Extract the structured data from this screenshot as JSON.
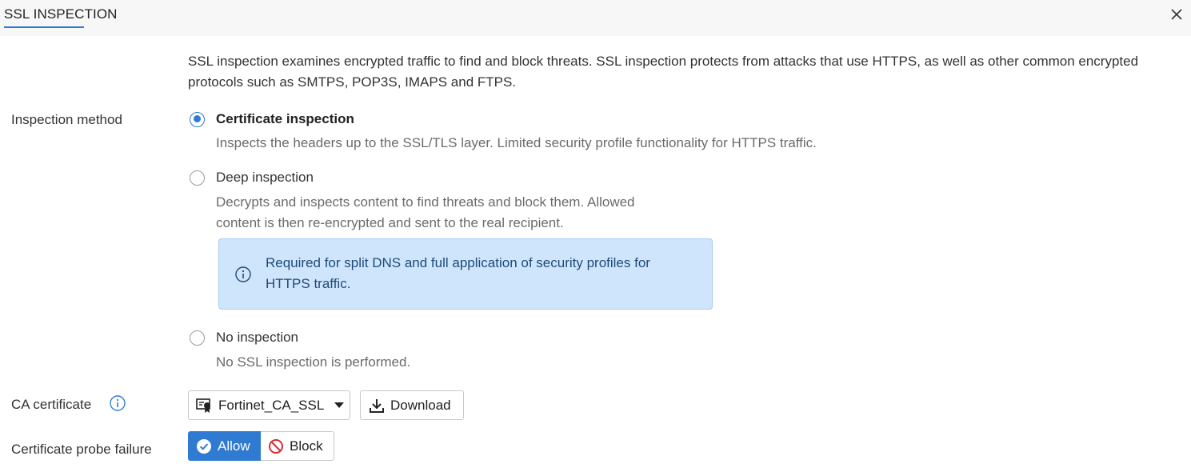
{
  "dialog": {
    "title": "SSL INSPECTION",
    "close_icon": "close-icon"
  },
  "intro": "SSL inspection examines encrypted traffic to find and block threats. SSL inspection protects from attacks that use HTTPS, as well as other common encrypted protocols such as SMTPS, POP3S, IMAPS and FTPS.",
  "inspection_method": {
    "label": "Inspection method",
    "options": [
      {
        "label": "Certificate inspection",
        "selected": true,
        "description": "Inspects the headers up to the SSL/TLS layer. Limited security profile functionality for HTTPS traffic."
      },
      {
        "label": "Deep inspection",
        "selected": false,
        "description_line1": "Decrypts and inspects content to find threats and block them. Allowed",
        "description_line2": "content is then re-encrypted and sent to the real recipient.",
        "info": {
          "icon": "info-icon",
          "line1": "Required for split DNS and full application of security profiles for",
          "line2": "HTTPS traffic."
        }
      },
      {
        "label": "No inspection",
        "selected": false,
        "description": "No SSL inspection is performed."
      }
    ]
  },
  "ca_certificate": {
    "label": "CA certificate",
    "help_icon": "info-icon",
    "selected_value": "Fortinet_CA_SSL",
    "download_label": "Download"
  },
  "probe_failure": {
    "label": "Certificate probe failure",
    "allow_label": "Allow",
    "block_label": "Block",
    "selected": "Allow"
  },
  "colors": {
    "accent": "#2f7bd1",
    "info_bg": "#cfe5fb",
    "info_text": "#1f4a7a",
    "block_red": "#d62f2f"
  }
}
